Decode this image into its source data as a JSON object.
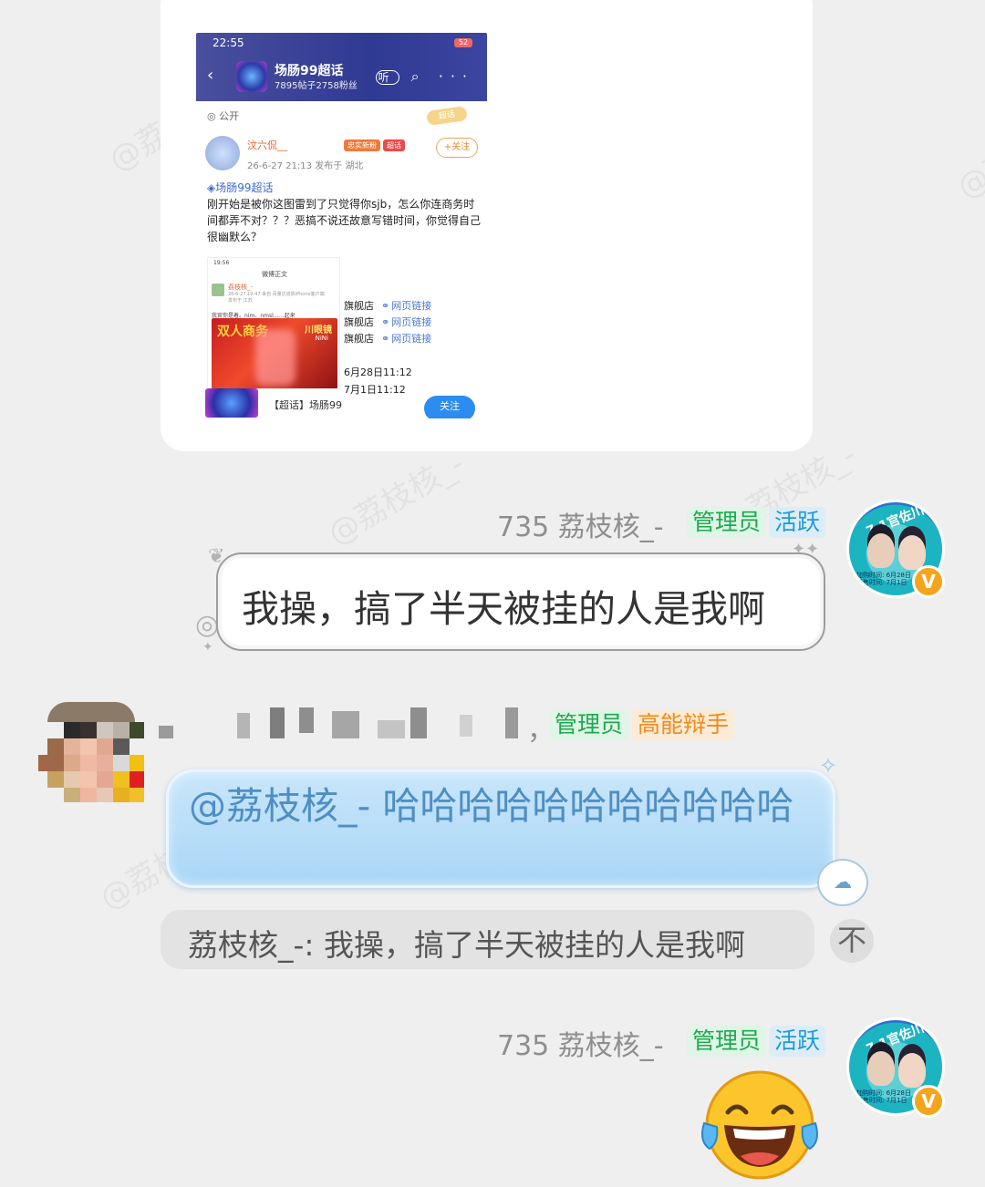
{
  "watermark": "@荔枝核_-",
  "shared_screenshot": {
    "status_time": "22:55",
    "battery": "52",
    "header": {
      "title": "场肠99超话",
      "subtitle": "7895帖子2758粉丝",
      "icons": [
        "back-icon",
        "listen-icon",
        "search-icon",
        "more-icon"
      ],
      "listen_label": "听"
    },
    "visibility": "公开",
    "tag": "超话",
    "post": {
      "author": "汶六侃__",
      "badges": [
        "忠实新粉",
        "超话"
      ],
      "follow": "+关注",
      "meta": "26-6-27 21:13  发布于 湖北",
      "topic": "场肠99超话",
      "text": "刚开始是被你这图雷到了只觉得你sjb，怎么你连商务时间都弄不对？？？恶搞不说还故意写错时间，你觉得自己很幽默么？",
      "inner": {
        "time": "19:56",
        "head": "微博正文",
        "author": "荔枝核_-",
        "meta": "26-6-27 19:47 来自 百量达道陈iPhone客户端",
        "loc": "发布于 江苏",
        "text": "我官你是着。nim、nmsl……起来",
        "promo1": "双人商务",
        "promo2": "川眼镜",
        "promo_sub": "NiNi"
      },
      "links": [
        {
          "store": "旗舰店",
          "link": "网页链接"
        },
        {
          "store": "旗舰店",
          "link": "网页链接"
        },
        {
          "store": "旗舰店",
          "link": "网页链接"
        }
      ],
      "dates": [
        "6月28日11:12",
        "7月1日11:12"
      ]
    },
    "bottom": {
      "label": "【超话】场肠99",
      "button": "关注"
    }
  },
  "messages": [
    {
      "sender": "735 荔枝核_-",
      "badges": [
        "管理员",
        "活跃"
      ],
      "avatar_text": "7.1官佐川眼镜",
      "avatar_info": [
        "加购时间: 6月28日",
        "开售时间: 7月1日"
      ],
      "avatar_badge": "V",
      "text": "我操，搞了半天被挂的人是我啊"
    },
    {
      "sender": "，",
      "badges": [
        "管理员",
        "高能辩手"
      ],
      "text": "@荔枝核_- 哈哈哈哈哈哈哈哈哈哈哈",
      "quote": "荔枝核_-: 我操，搞了半天被挂的人是我啊",
      "quote_button": "不"
    },
    {
      "sender": "735 荔枝核_-",
      "badges": [
        "管理员",
        "活跃"
      ],
      "avatar_text": "7.1官佐川眼镜",
      "avatar_info": [
        "加购时间: 6月28日",
        "开售时间: 7月1日"
      ],
      "avatar_badge": "V",
      "emoji": "laughing-tears-emoji"
    }
  ]
}
